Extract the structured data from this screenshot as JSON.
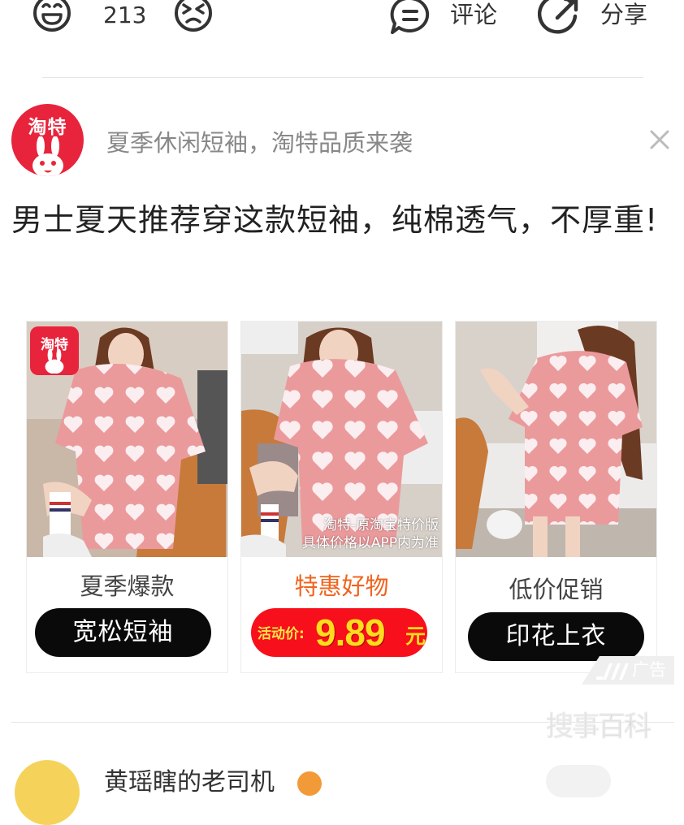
{
  "actions": {
    "like_count": "213",
    "comment_label": "评论",
    "share_label": "分享"
  },
  "ad": {
    "avatar_text": "淘特",
    "sponsor_text": "夏季休闲短袖，淘特品质来袭",
    "headline": "男士夏天推荐穿这款短袖，纯棉透气，不厚重!",
    "logo_badge": "淘特",
    "watermark_line1": "淘特-原淘宝特价版",
    "watermark_line2": "具体价格以APP内为准",
    "cards": [
      {
        "title": "夏季爆款",
        "button": "宽松短袖"
      },
      {
        "title": "特惠好物",
        "price_label": "活动价:",
        "price_value": "9.89",
        "price_unit": "元"
      },
      {
        "title": "低价促销",
        "button": "印花上衣"
      }
    ],
    "ad_tag": "广告",
    "colors": {
      "accent_red": "#e8243c",
      "title_red": "#f0641e",
      "price_red": "#f7101c",
      "price_yellow": "#ffdd1e"
    }
  },
  "logo_watermark": "搜事百科",
  "next_post": {
    "author": "黄瑶瞎的老司机"
  },
  "icons": [
    "laugh-icon",
    "angry-icon",
    "comment-icon",
    "share-icon",
    "close-icon"
  ]
}
